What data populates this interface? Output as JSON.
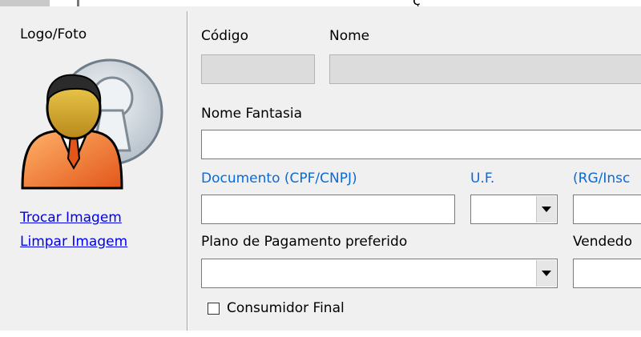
{
  "left_panel": {
    "title": "Logo/Foto",
    "change_image": "Trocar Imagem",
    "clear_image": "Limpar Imagem",
    "avatar_icon": "person-with-keyhole-icon"
  },
  "form": {
    "top_partial_text": "ç",
    "codigo_label": "Código",
    "codigo_value": "",
    "nome_label": "Nome",
    "nome_value": "",
    "nome_fantasia_label": "Nome Fantasia",
    "nome_fantasia_value": "",
    "documento_label": "Documento (CPF/CNPJ)",
    "documento_value": "",
    "uf_label": "U.F.",
    "uf_value": "",
    "rg_label": "(RG/Insc",
    "rg_value": "",
    "plano_label": "Plano de Pagamento preferido",
    "plano_value": "",
    "vendedor_label": "Vendedo",
    "vendedor_value": "",
    "consumidor_final_label": "Consumidor Final",
    "consumidor_final_checked": false
  },
  "colors": {
    "required_label": "#0a6ad8",
    "link": "#0000ee",
    "background": "#f0f0f0"
  }
}
